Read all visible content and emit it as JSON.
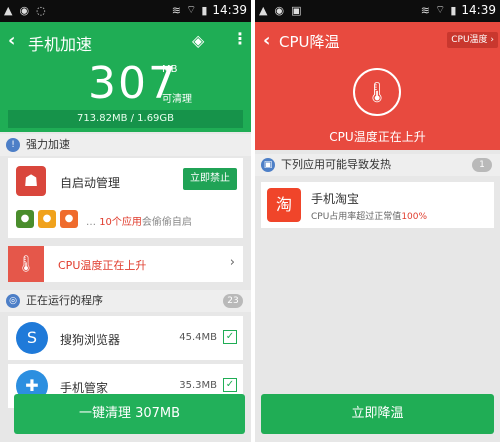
{
  "status": {
    "left_icons": [
      "warning-icon",
      "notification-icon",
      "bluetooth-icon"
    ],
    "time": "14:39"
  },
  "left": {
    "title": "手机加速",
    "big_value": "307",
    "unit": "MB",
    "unit_sub": "可清理",
    "usage": "713.82MB / 1.69GB",
    "section1": "强力加速",
    "startup_label": "自启动管理",
    "forbid_button": "立即禁止",
    "apps_count": "10个应用",
    "apps_note_rest": "会偷偷自启",
    "cpu_warning": "CPU温度正在上升",
    "section2": "正在运行的程序",
    "running_count": "23",
    "apps": [
      {
        "name": "搜狗浏览器",
        "size": "45.4MB"
      },
      {
        "name": "手机管家",
        "size": "35.3MB"
      }
    ],
    "clean_button": "一键清理 307MB"
  },
  "right": {
    "title": "CPU降温",
    "tag": "CPU温度 ›",
    "status_text": "CPU温度正在上升",
    "section": "下列应用可能导致发热",
    "count": "1",
    "app_name": "手机淘宝",
    "app_sub": "CPU占用率超过正常值",
    "app_sub_pct": "100%",
    "cool_button": "立即降温"
  },
  "colors": {
    "green": "#1fad55",
    "red": "#e84a3f"
  }
}
